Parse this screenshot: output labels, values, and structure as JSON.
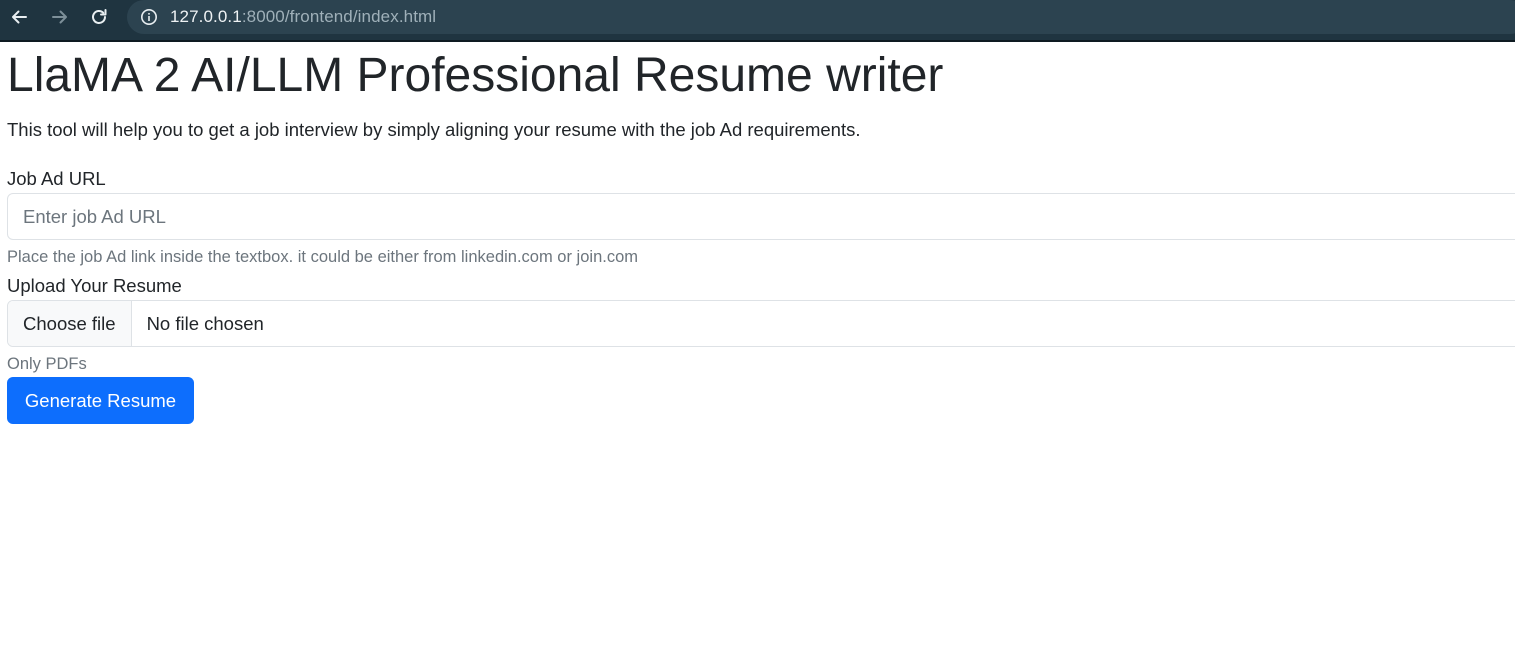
{
  "browser": {
    "url_host": "127.0.0.1",
    "url_path": ":8000/frontend/index.html",
    "icons": {
      "back": "back-arrow-icon",
      "forward": "forward-arrow-icon",
      "reload": "reload-icon",
      "site_info": "info-icon"
    }
  },
  "page": {
    "title": "LlaMA 2 AI/LLM Professional Resume writer",
    "lead": "This tool will help you to get a job interview by simply aligning your resume with the job Ad requirements."
  },
  "form": {
    "job_url": {
      "label": "Job Ad URL",
      "placeholder": "Enter job Ad URL",
      "value": "",
      "help": "Place the job Ad link inside the textbox. it could be either from linkedin.com or join.com"
    },
    "resume": {
      "label": "Upload Your Resume",
      "button_label": "Choose file",
      "status": "No file chosen",
      "help": "Only PDFs"
    },
    "submit_label": "Generate Resume"
  },
  "colors": {
    "browser_bar": "#1f3440",
    "omnibox": "#2c4350",
    "primary": "#0d6efd",
    "muted_text": "#6c757d",
    "border": "#dee2e6"
  }
}
